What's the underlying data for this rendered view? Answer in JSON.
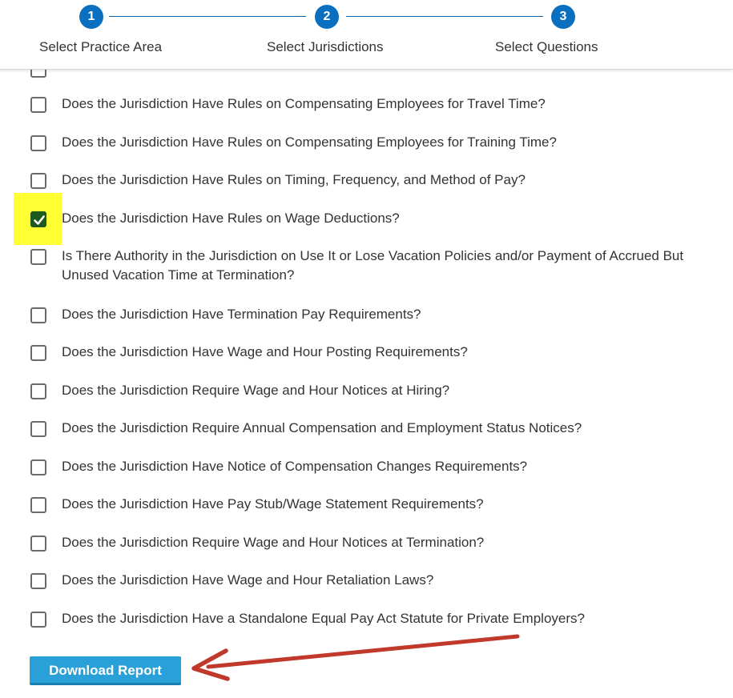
{
  "stepper": {
    "steps": [
      {
        "number": "1",
        "label": "Select Practice Area"
      },
      {
        "number": "2",
        "label": "Select Jurisdictions"
      },
      {
        "number": "3",
        "label": "Select Questions"
      }
    ],
    "active_color": "#0a6fbf"
  },
  "questions": [
    {
      "text": "Does the Jurisdiction Have Rules on Compensating Employees for Travel Time?",
      "checked": false
    },
    {
      "text": "Does the Jurisdiction Have Rules on Compensating Employees for Training Time?",
      "checked": false
    },
    {
      "text": "Does the Jurisdiction Have Rules on Timing, Frequency, and Method of Pay?",
      "checked": false
    },
    {
      "text": "Does the Jurisdiction Have Rules on Wage Deductions?",
      "checked": true
    },
    {
      "text": "Is There Authority in the Jurisdiction on Use It or Lose Vacation Policies and/or Payment of Accrued But Unused Vacation Time at Termination?",
      "checked": false
    },
    {
      "text": "Does the Jurisdiction Have Termination Pay Requirements?",
      "checked": false
    },
    {
      "text": "Does the Jurisdiction Have Wage and Hour Posting Requirements?",
      "checked": false
    },
    {
      "text": "Does the Jurisdiction Require Wage and Hour Notices at Hiring?",
      "checked": false
    },
    {
      "text": "Does the Jurisdiction Require Annual Compensation and Employment Status Notices?",
      "checked": false
    },
    {
      "text": "Does the Jurisdiction Have Notice of Compensation Changes Requirements?",
      "checked": false
    },
    {
      "text": "Does the Jurisdiction Have Pay Stub/Wage Statement Requirements?",
      "checked": false
    },
    {
      "text": "Does the Jurisdiction Require Wage and Hour Notices at Termination?",
      "checked": false
    },
    {
      "text": "Does the Jurisdiction Have Wage and Hour Retaliation Laws?",
      "checked": false
    },
    {
      "text": "Does the Jurisdiction Have a Standalone Equal Pay Act Statute for Private Employers?",
      "checked": false
    }
  ],
  "actions": {
    "download_label": "Download Report"
  },
  "colors": {
    "button": "#2aa0d8",
    "checked": "#1e5a1e",
    "highlight": "#ffff33",
    "annotation_arrow": "#c0392b"
  }
}
